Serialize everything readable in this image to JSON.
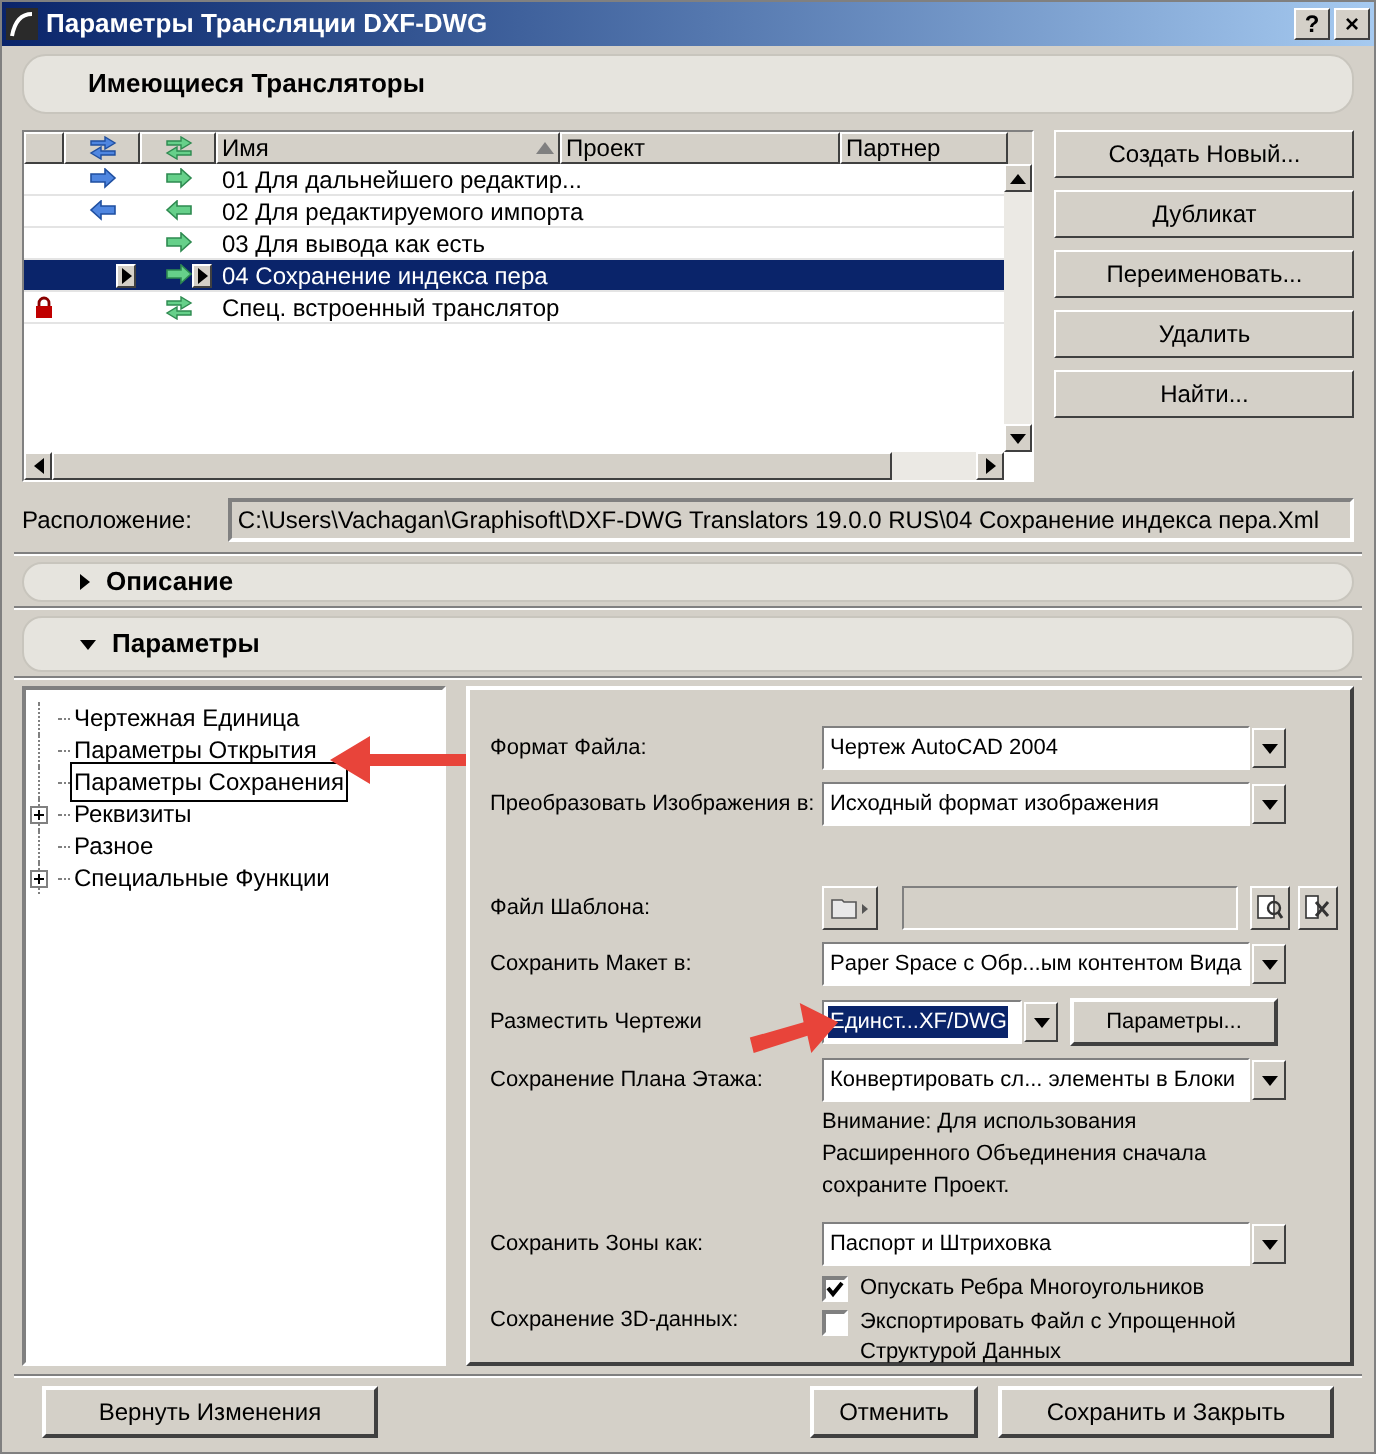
{
  "window": {
    "title": "Параметры Трансляции DXF-DWG",
    "title_buttons": [
      "?",
      "×"
    ]
  },
  "translators_header": "Имеющиеся Трансляторы",
  "table": {
    "columns": [
      {
        "kind": "lock"
      },
      {
        "kind": "blue"
      },
      {
        "kind": "green"
      },
      {
        "kind": "text",
        "label": "Имя",
        "sorted": true
      },
      {
        "kind": "text",
        "label": "Проект",
        "sorted": false
      },
      {
        "kind": "text",
        "label": "Партнер",
        "sorted": false
      }
    ],
    "rows": [
      {
        "name": "01 Для дальнейшего редактир...",
        "blue_export": true,
        "blue_import": false,
        "green_export": true,
        "green_import": false,
        "locked": false,
        "selected": false
      },
      {
        "name": "02 Для редактируемого импорта",
        "blue_export": false,
        "blue_import": true,
        "green_export": false,
        "green_import": true,
        "locked": false,
        "selected": false
      },
      {
        "name": "03 Для вывода как есть",
        "blue_export": false,
        "blue_import": false,
        "green_export": true,
        "green_import": false,
        "locked": false,
        "selected": false
      },
      {
        "name": "04 Сохранение индекса пера",
        "blue_export": false,
        "blue_import": false,
        "green_export": true,
        "green_import": false,
        "locked": false,
        "selected": true
      },
      {
        "name": "Спец. встроенный транслятор",
        "blue_export": false,
        "blue_import": false,
        "green_export": true,
        "green_import": true,
        "locked": true,
        "selected": false
      }
    ]
  },
  "side_buttons": [
    "Создать Новый...",
    "Дубликат",
    "Переименовать...",
    "Удалить",
    "Найти..."
  ],
  "location": {
    "label": "Расположение:",
    "value": "C:\\Users\\Vachagan\\Graphisoft\\DXF-DWG Translators 19.0.0 RUS\\04 Сохранение индекса пера.Xml"
  },
  "sections": [
    {
      "title": "Описание",
      "expanded": false
    },
    {
      "title": "Параметры",
      "expanded": true
    }
  ],
  "tree": [
    {
      "label": "Чертежная Единица",
      "kind": "leaf",
      "selected": false
    },
    {
      "label": "Параметры Открытия",
      "kind": "leaf",
      "selected": false
    },
    {
      "label": "Параметры Сохранения",
      "kind": "leaf",
      "selected": true
    },
    {
      "label": "Реквизиты",
      "kind": "branch",
      "expanded": false,
      "selected": false
    },
    {
      "label": "Разное",
      "kind": "leaf",
      "selected": false
    },
    {
      "label": "Специальные Функции",
      "kind": "branch",
      "expanded": false,
      "selected": false
    }
  ],
  "fields": [
    {
      "kind": "dropdown",
      "label": "Формат Файла:",
      "value": "Чертеж AutoCAD 2004"
    },
    {
      "kind": "dropdown",
      "label": "Преобразовать Изображения в:",
      "value": "Исходный формат изображения"
    },
    {
      "kind": "file",
      "label": "Файл Шаблона:"
    },
    {
      "kind": "dropdown",
      "label": "Сохранить Макет в:",
      "value": "Paper Space с Обр...ым контентом Вида"
    },
    {
      "kind": "dropdown_button",
      "label": "Разместить Чертежи",
      "value": "Единст...XF/DWG",
      "focused": true,
      "button": "Параметры..."
    },
    {
      "kind": "dropdown",
      "label": "Сохранение Плана Этажа:",
      "value": "Конвертировать сл... элементы в Блоки"
    },
    {
      "kind": "note",
      "text": "Внимание: Для использования Расширенного Объединения сначала сохраните Проект."
    },
    {
      "kind": "dropdown",
      "label": "Сохранить Зоны как:",
      "value": "Паспорт и Штриховка"
    },
    {
      "kind": "checkboxes",
      "label": "Сохранение 3D-данных:",
      "options": [
        {
          "label": "Опускать Ребра Многоугольников",
          "checked": true
        },
        {
          "label": "Экспортировать Файл с Упрощенной Структурой Данных",
          "checked": false
        }
      ]
    }
  ],
  "footer": {
    "left": "Вернуть Изменения",
    "buttons": [
      "Отменить",
      "Сохранить и Закрыть"
    ]
  }
}
